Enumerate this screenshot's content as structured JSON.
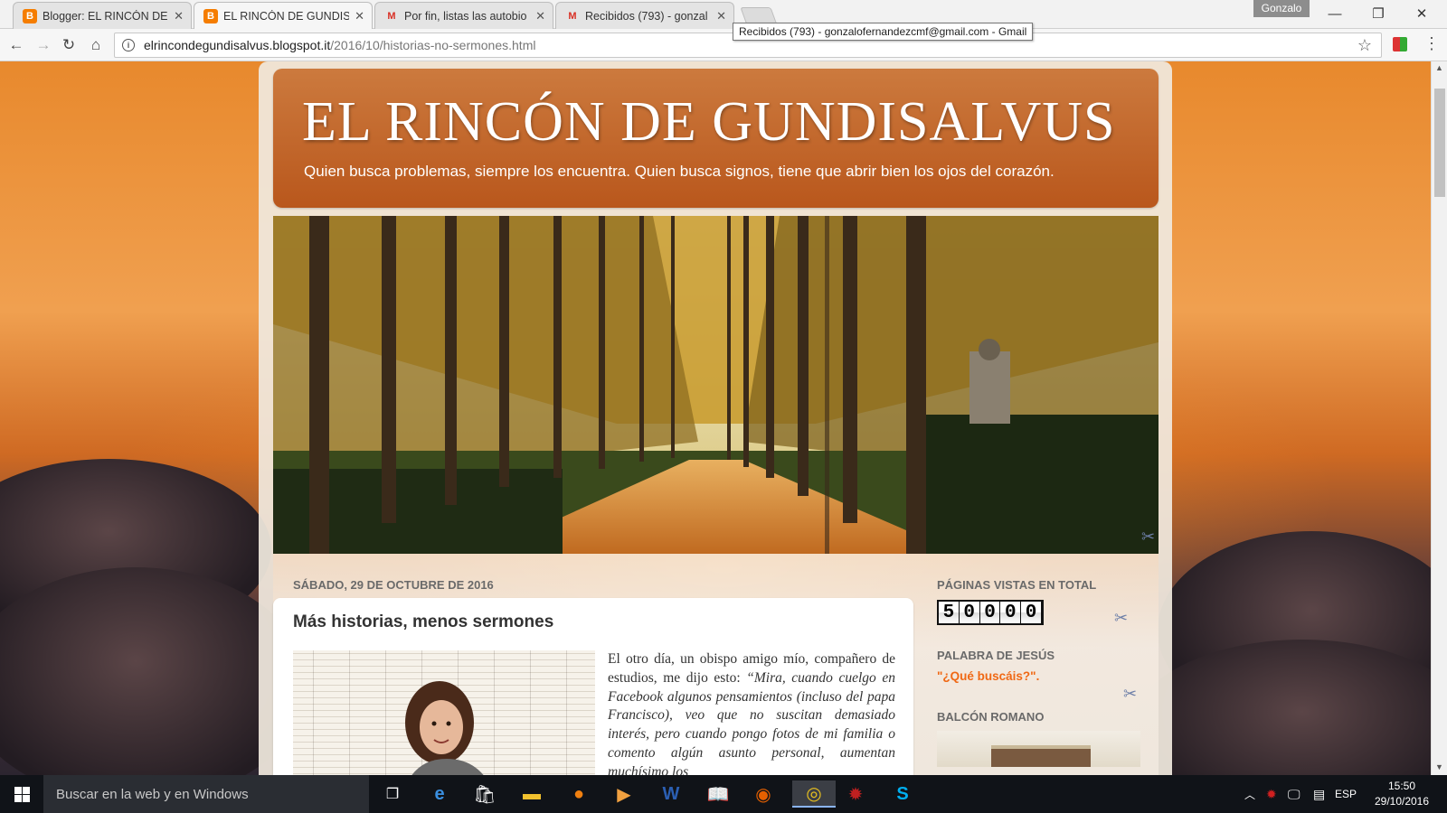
{
  "browser": {
    "tabs": [
      {
        "title": "Blogger: EL RINCÓN DE",
        "favicon": "blogger-icon"
      },
      {
        "title": "EL RINCÓN DE GUNDISA",
        "favicon": "blogger-icon"
      },
      {
        "title": "Por fin, listas las autobio",
        "favicon": "gmail-icon"
      },
      {
        "title": "Recibidos (793) - gonzal",
        "favicon": "gmail-icon"
      }
    ],
    "profile_name": "Gonzalo",
    "url_host": "elrincondegundisalvus.blogspot.it",
    "url_path": "/2016/10/historias-no-sermones.html",
    "tooltip": "Recibidos (793) - gonzalofernandezcmf@gmail.com - Gmail"
  },
  "blog": {
    "title": "EL RINCÓN DE GUNDISALVUS",
    "description": "Quien busca problemas, siempre los encuentra. Quien busca signos, tiene que abrir bien los ojos del corazón."
  },
  "post": {
    "date": "SÁBADO, 29 DE OCTUBRE DE 2016",
    "title": "Más historias, menos sermones",
    "text_plain_1": "El otro día, un obispo amigo mío, compañero de estudios, me dijo esto: ",
    "text_italic_1": "“Mira, cuando cuelgo en Facebook ",
    "text_plain_2": "algunos pensamientos (incluso del papa Francisco), veo que no suscitan demasiado interés, pero cuando pongo fotos de mi familia o comento algún asunto personal, aumentan muchísimo los"
  },
  "sidebar": {
    "pageviews_title": "PÁGINAS VISTAS EN TOTAL",
    "pageviews_digits": [
      "5",
      "0",
      "0",
      "0",
      "0"
    ],
    "palabra_title": "PALABRA DE JESÚS",
    "palabra_quote": "\"¿Qué buscáis?\".",
    "balcon_title": "BALCÓN ROMANO"
  },
  "taskbar": {
    "search_placeholder": "Buscar en la web y en Windows",
    "language": "ESP",
    "time": "15:50",
    "date": "29/10/2016"
  },
  "colors": {
    "header_orange": "#c0621f",
    "quote_orange": "#f06814"
  }
}
